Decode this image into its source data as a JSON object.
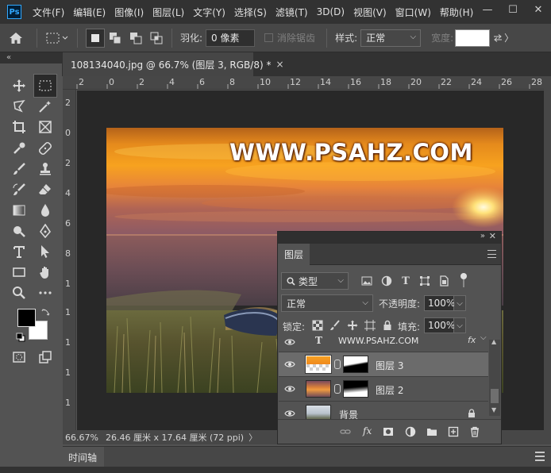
{
  "app": {
    "logo_text": "Ps"
  },
  "menu": {
    "items": [
      "文件(F)",
      "编辑(E)",
      "图像(I)",
      "图层(L)",
      "文字(Y)",
      "选择(S)",
      "滤镜(T)",
      "3D(D)",
      "视图(V)",
      "窗口(W)",
      "帮助(H)"
    ]
  },
  "window_controls": {
    "minimize": "—",
    "maximize": "☐",
    "close": "✕"
  },
  "options_bar": {
    "feather_label": "羽化:",
    "feather_value": "0 像素",
    "antialias_label": "消除锯齿",
    "style_label": "样式:",
    "style_value": "正常",
    "width_label": "宽度:"
  },
  "document_tab": {
    "title": "108134040.jpg @ 66.7% (图层 3, RGB/8) *",
    "close": "×"
  },
  "ruler_top": {
    "labels": [
      "2",
      "0",
      "2",
      "4",
      "6",
      "8",
      "10",
      "12",
      "14",
      "16",
      "18",
      "20",
      "22",
      "24",
      "26",
      "28"
    ]
  },
  "ruler_left": {
    "labels": [
      "2",
      "0",
      "2",
      "4",
      "6",
      "8",
      "1",
      "1",
      "1",
      "1",
      "1",
      "1",
      "1",
      "1"
    ]
  },
  "image": {
    "watermark": "WWW.PSAHZ.COM"
  },
  "status_bar": {
    "zoom": "66.67%",
    "doc_info": "26.46 厘米 x 17.64 厘米 (72 ppi)",
    "arrow": "〉"
  },
  "timeline": {
    "label": "时间轴"
  },
  "layers_panel": {
    "tab_label": "图层",
    "filter_kind": "类型",
    "blend_mode": "正常",
    "opacity_label": "不透明度:",
    "opacity_value": "100%",
    "lock_label": "锁定:",
    "fill_label": "填充:",
    "fill_value": "100%",
    "layers": [
      {
        "name": "WWW.PSAHZ.COM",
        "type": "text",
        "fx": "fx",
        "selected": false
      },
      {
        "name": "图层 3",
        "type": "masked",
        "selected": true
      },
      {
        "name": "图层 2",
        "type": "masked",
        "selected": false
      },
      {
        "name": "背景",
        "type": "background",
        "locked": true,
        "selected": false
      }
    ],
    "footer_fx": "fx"
  },
  "colors": {
    "foreground": "#000000",
    "background": "#ffffff",
    "accent": "#31a8ff"
  }
}
